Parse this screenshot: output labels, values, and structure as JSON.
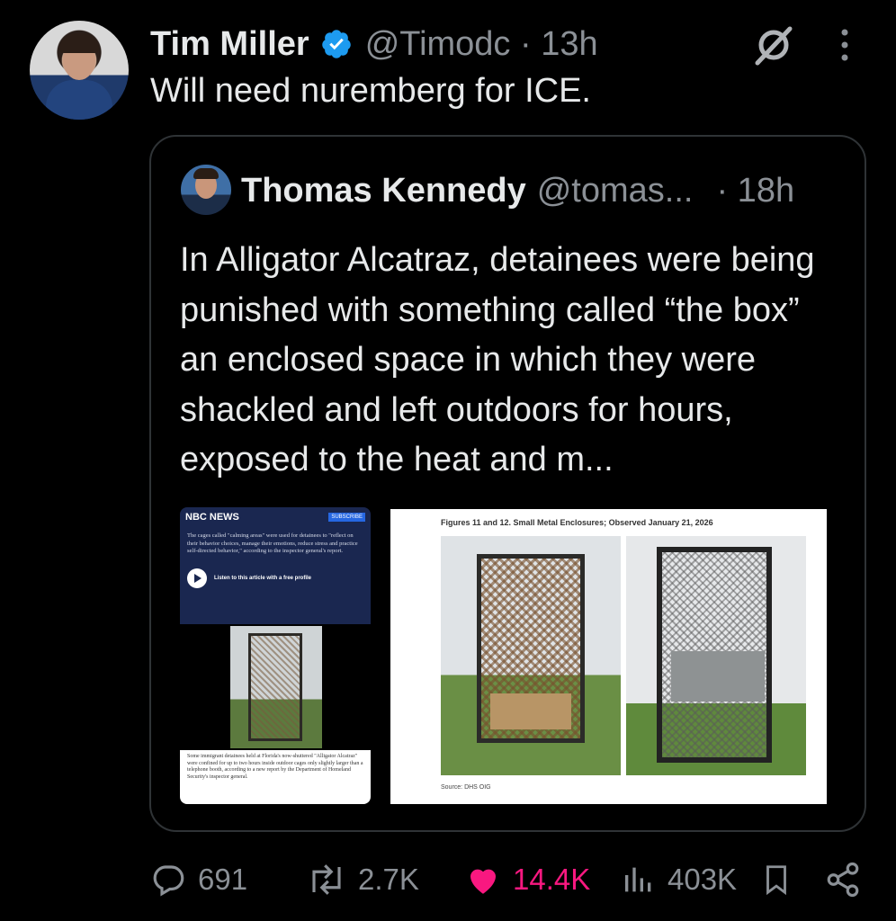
{
  "tweet": {
    "author_name": "Tim Miller",
    "handle": "@Timodc",
    "separator": "·",
    "time": "13h",
    "text": "Will need nuremberg for ICE."
  },
  "quote": {
    "author_name": "Thomas Kennedy",
    "handle": "@tomas...",
    "time": "· 18h",
    "text": "In Alligator Alcatraz, detainees were being punished with something called “the box” an enclosed space in which they were shackled and left outdoors for hours, exposed to the heat and m..."
  },
  "image_nbc": {
    "logo": "NBC NEWS",
    "subscribe": "SUBSCRIBE",
    "paragraph": "The cages called \"calming areas\" were used for detainees to \"reflect on their behavior choices, manage their emotions, reduce stress and practice self-directed behavior,\" according to the inspector general's report.",
    "listen": "Listen to this article with a free profile",
    "caption": "Some immigrant detainees held at Florida's now-shuttered \"Alligator Alcatraz\" were confined for up to two hours inside outdoor cages only slightly larger than a telephone booth, according to a new report by the Department of Homeland Security's inspector general."
  },
  "image_report": {
    "title": "Figures 11 and 12. Small Metal Enclosures; Observed January 21, 2026",
    "source": "Source: DHS OIG"
  },
  "actions": {
    "replies": "691",
    "reposts": "2.7K",
    "likes": "14.4K",
    "views": "403K"
  },
  "colors": {
    "background": "#000000",
    "text": "#e7e9ea",
    "muted": "#8b9096",
    "verified": "#1d9bf0",
    "like": "#f91880",
    "border": "#2f3336"
  },
  "icons": [
    "verified-badge-icon",
    "grok-icon",
    "more-icon",
    "reply-icon",
    "repost-icon",
    "like-icon",
    "views-icon",
    "bookmark-icon",
    "share-icon"
  ]
}
